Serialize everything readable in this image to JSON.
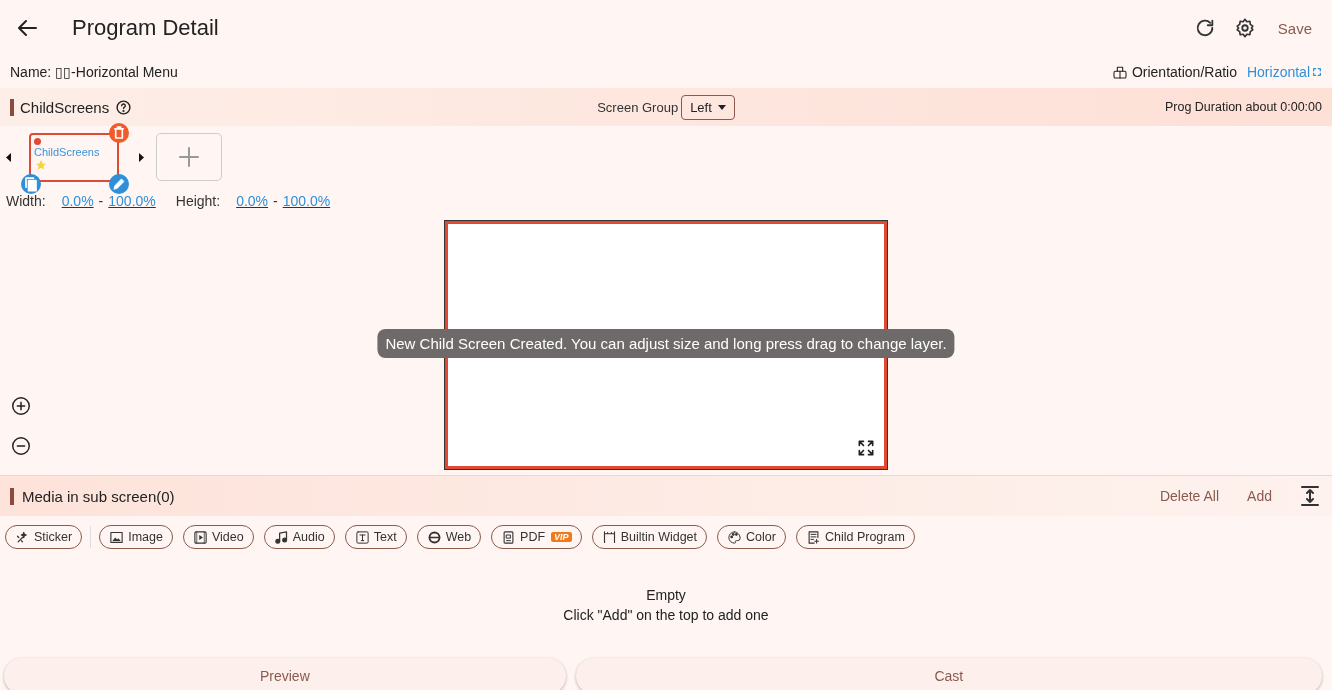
{
  "header": {
    "title": "Program Detail",
    "save": "Save"
  },
  "program": {
    "name": "Name: ▯▯-Horizontal Menu",
    "orientation_label": "Orientation/Ratio",
    "orientation_value": "Horizontal"
  },
  "child_screens": {
    "title": "ChildScreens",
    "screen_group_label": "Screen Group",
    "screen_group_value": "Left",
    "duration": "Prog Duration about 0:00:00",
    "screens": [
      {
        "label": "ChildScreens",
        "selected": true
      }
    ],
    "width_label": "Width:",
    "width_from": "0.0%",
    "width_sep": "-",
    "width_to": "100.0%",
    "height_label": "Height:",
    "height_from": "0.0%",
    "height_sep": "-",
    "height_to": "100.0%"
  },
  "toast": "New Child Screen Created. You can adjust size and long press drag to change layer.",
  "media": {
    "title": "Media in sub screen(0)",
    "delete_all": "Delete All",
    "add": "Add",
    "types": [
      {
        "kind": "sticker",
        "label": "Sticker"
      },
      {
        "kind": "image",
        "label": "Image"
      },
      {
        "kind": "video",
        "label": "Video"
      },
      {
        "kind": "audio",
        "label": "Audio"
      },
      {
        "kind": "text",
        "label": "Text"
      },
      {
        "kind": "web",
        "label": "Web"
      },
      {
        "kind": "pdf",
        "label": "PDF",
        "badge": "VIP"
      },
      {
        "kind": "widget",
        "label": "Builtin Widget"
      },
      {
        "kind": "color",
        "label": "Color"
      },
      {
        "kind": "program",
        "label": "Child Program"
      }
    ],
    "empty_title": "Empty",
    "empty_hint": "Click \"Add\" on the top to add one"
  },
  "footer": {
    "buttons": [
      "Preview",
      "Cast"
    ]
  }
}
